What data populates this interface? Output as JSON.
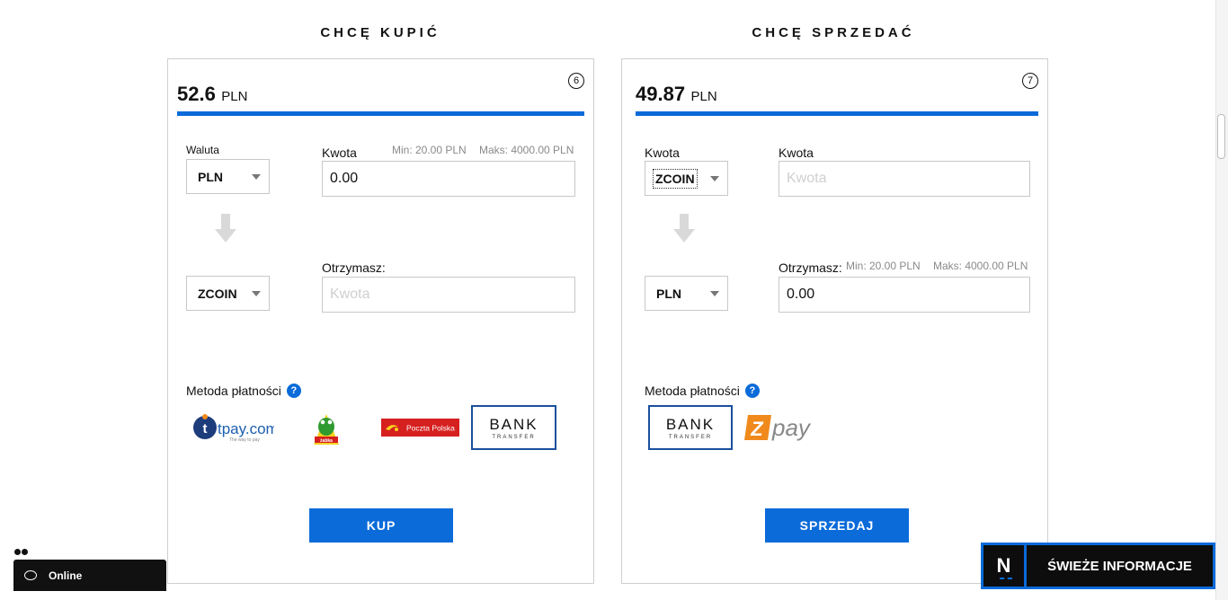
{
  "buy": {
    "title": "CHCĘ KUPIĆ",
    "badge": "6",
    "price_amount": "52.6",
    "price_currency": "PLN",
    "currency_label": "Waluta",
    "amount_label": "Kwota",
    "min_hint": "Min: 20.00 PLN",
    "max_hint": "Maks: 4000.00 PLN",
    "from_currency": "PLN",
    "amount_value": "0.00",
    "to_currency": "ZCOIN",
    "receive_label": "Otrzymasz:",
    "receive_placeholder": "Kwota",
    "payment_label": "Metoda płatności",
    "help": "?",
    "methods": {
      "tpay": "tpay.com",
      "tpay_tagline": "The way to pay",
      "zabka": "żabka",
      "poczta": "Poczta Polska",
      "bank_top": "BANK",
      "bank_bottom": "TRANSFER"
    },
    "button": "KUP"
  },
  "sell": {
    "title": "CHCĘ SPRZEDAĆ",
    "badge": "7",
    "price_amount": "49.87",
    "price_currency": "PLN",
    "amount_label_left": "Kwota",
    "amount_label_right": "Kwota",
    "from_currency": "ZCOIN",
    "amount_placeholder": "Kwota",
    "receive_label": "Otrzymasz:",
    "min_hint": "Min: 20.00 PLN",
    "max_hint": "Maks: 4000.00 PLN",
    "to_currency": "PLN",
    "receive_value": "0.00",
    "payment_label": "Metoda płatności",
    "help": "?",
    "methods": {
      "bank_top": "BANK",
      "bank_bottom": "TRANSFER",
      "zpay": "pay",
      "zpay_z": "Z"
    },
    "button": "SPRZEDAJ"
  },
  "chat": {
    "status": "Online"
  },
  "news": {
    "logo": "N",
    "label": "ŚWIEŻE INFORMACJE"
  },
  "colors": {
    "accent": "#0a6bd9",
    "dark": "#111111"
  },
  "icons": [
    "arrow-down-icon",
    "help-icon",
    "chat-icon",
    "caret-down-icon"
  ]
}
